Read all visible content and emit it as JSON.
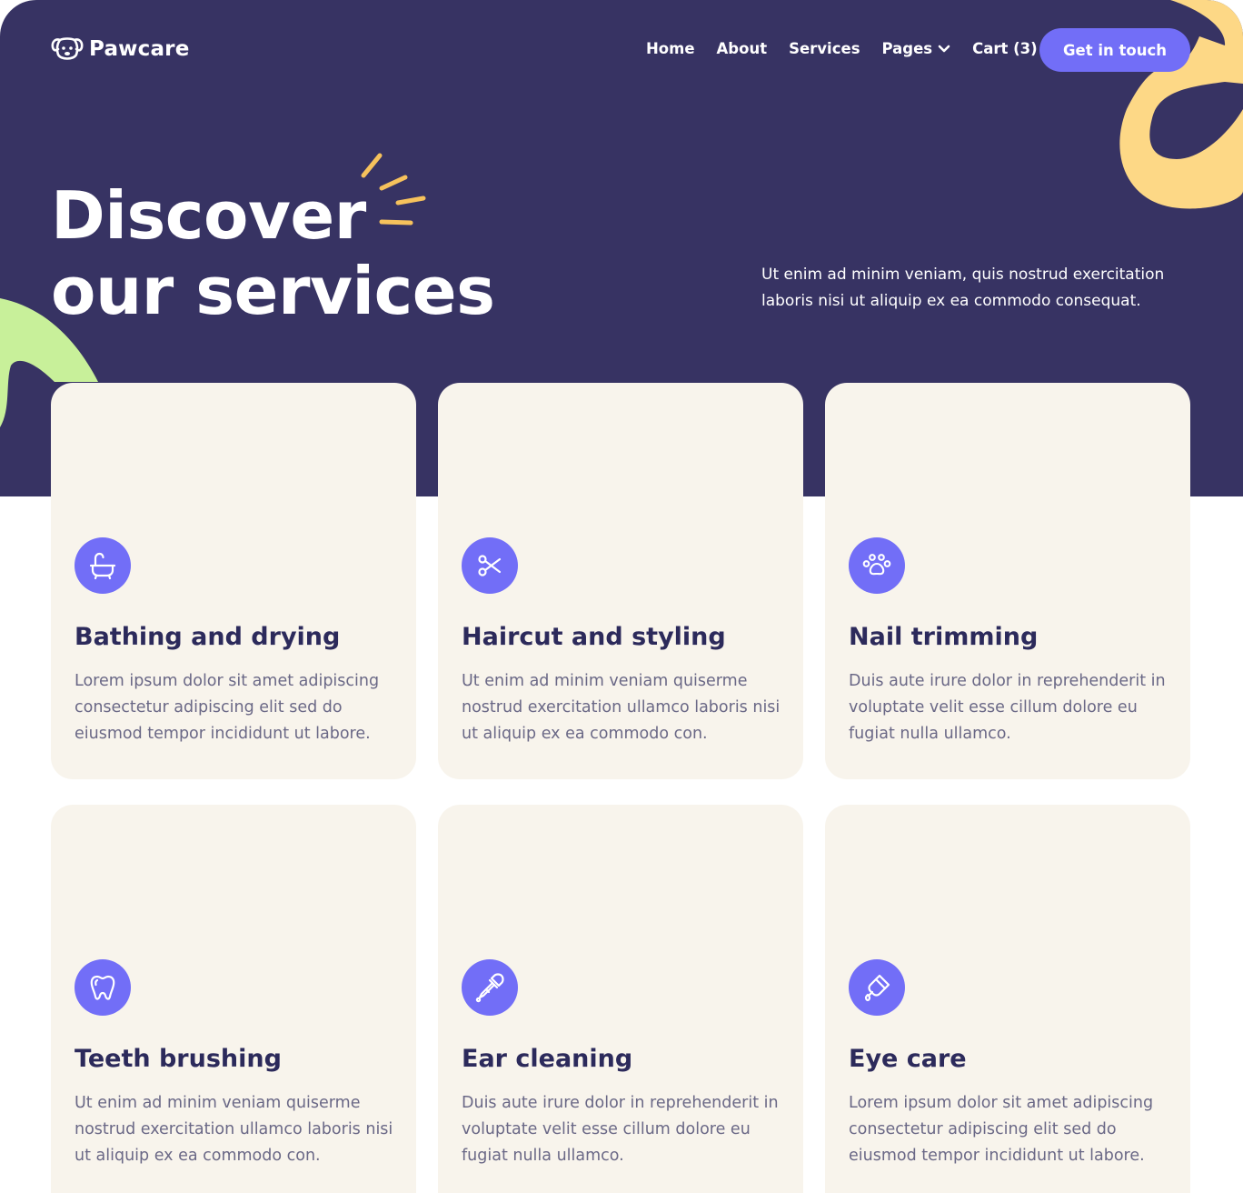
{
  "brand": {
    "name": "Pawcare",
    "icon": "dog-face-icon"
  },
  "nav": {
    "items": [
      {
        "label": "Home"
      },
      {
        "label": "About"
      },
      {
        "label": "Services"
      },
      {
        "label": "Pages",
        "icon": "chevron-down-icon"
      },
      {
        "label": "Cart (3)"
      }
    ],
    "cta": "Get in touch"
  },
  "hero": {
    "title_line1": "Discover",
    "title_line2": "our services",
    "description": "Ut enim ad minim veniam, quis nostrud exercitation laboris nisi ut aliquip ex ea commodo consequat."
  },
  "services": [
    {
      "title": "Bathing and drying",
      "description": "Lorem ipsum dolor sit amet adipiscing consectetur adipiscing elit sed do eiusmod tempor incididunt ut labore.",
      "icon": "bathtub-icon"
    },
    {
      "title": "Haircut and styling",
      "description": "Ut enim ad minim veniam  quiserme nostrud exercitation ullamco laboris nisi ut aliquip ex ea commodo con.",
      "icon": "scissors-icon"
    },
    {
      "title": "Nail trimming",
      "description": "Duis aute irure dolor in reprehenderit in voluptate velit esse cillum dolore eu fugiat nulla ullamco.",
      "icon": "paw-icon"
    },
    {
      "title": "Teeth brushing",
      "description": "Ut enim ad minim veniam  quiserme nostrud exercitation ullamco laboris nisi ut aliquip ex ea commodo con.",
      "icon": "tooth-icon"
    },
    {
      "title": "Ear cleaning",
      "description": "Duis aute irure dolor in reprehenderit in voluptate velit esse cillum dolore eu fugiat nulla ullamco.",
      "icon": "dropper-icon"
    },
    {
      "title": "Eye care",
      "description": "Lorem ipsum dolor sit amet adipiscing consectetur adipiscing elit sed do eiusmod tempor incididunt ut labore.",
      "icon": "eye-drops-icon"
    }
  ],
  "colors": {
    "hero_bg": "#373363",
    "accent": "#726ef7",
    "card_bg": "#f8f4ec",
    "heading": "#2c2a5b",
    "body_text": "#6a6886",
    "deco_yellow": "#fdd886",
    "deco_green": "#c8f09a"
  }
}
